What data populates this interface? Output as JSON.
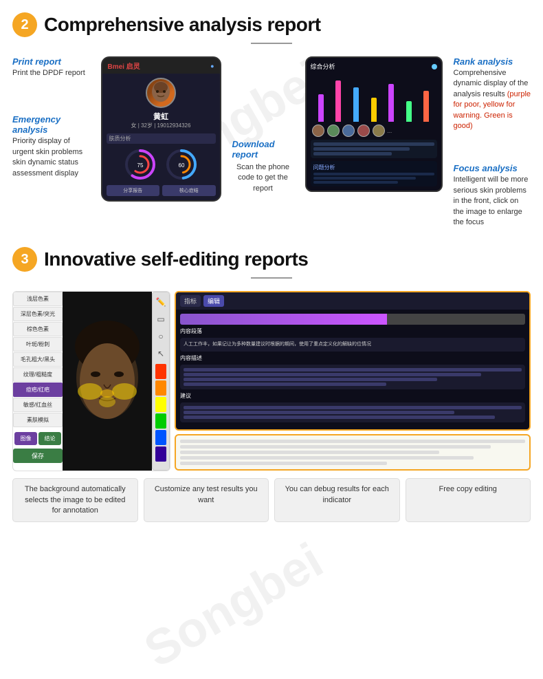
{
  "section1": {
    "number": "2",
    "title": "Comprehensive analysis report",
    "annotations_left": [
      {
        "label": "Print report",
        "text": "Print the DPDF report"
      },
      {
        "label": "Emergency analysis",
        "text": "Priority display of urgent skin problems skin dynamic status assessment display"
      }
    ],
    "annotations_middle": {
      "label": "Download report",
      "text": "Scan the phone code to get the report"
    },
    "annotations_right": [
      {
        "label": "Rank analysis",
        "text": "Comprehensive dynamic display of the analysis results ",
        "highlight": "(purple for poor, yellow for warning. Green is good)"
      },
      {
        "label": "Focus analysis",
        "text": "Intelligent will be more serious skin problems in the front, click on the image to enlarge the focus"
      }
    ],
    "phone_name": "黄虹",
    "watermark": "Songbei"
  },
  "section2": {
    "number": "3",
    "title": "Innovative self-editing reports",
    "sidebar_items": [
      {
        "label": "浅层色素",
        "active": false
      },
      {
        "label": "深层色素/突光",
        "active": false
      },
      {
        "label": "棕色色素",
        "active": false
      },
      {
        "label": "叶斑/粉刺",
        "active": false
      },
      {
        "label": "毛孔粗大/黑头",
        "active": false
      },
      {
        "label": "纹理/粗糙度",
        "active": false
      },
      {
        "label": "痘疤/红疤",
        "active": true
      },
      {
        "label": "敏感/红血丝",
        "active": false
      },
      {
        "label": "素肤模拟",
        "active": false
      }
    ],
    "right_tabs": [
      "图像",
      "结论"
    ],
    "active_tab": "图像",
    "save_btn": "保存",
    "editor_tabs": [
      "",
      ""
    ],
    "captions": [
      "The background automatically selects the image to be edited for annotation",
      "Customize any test results you want",
      "You can debug results for each indicator",
      "Free copy editing"
    ],
    "colors": [
      "#ff3300",
      "#ff8800",
      "#ffff00",
      "#00cc00",
      "#0055ff",
      "#330099"
    ],
    "report_labels": [
      "内容段落",
      "内容描述",
      "建议"
    ]
  }
}
